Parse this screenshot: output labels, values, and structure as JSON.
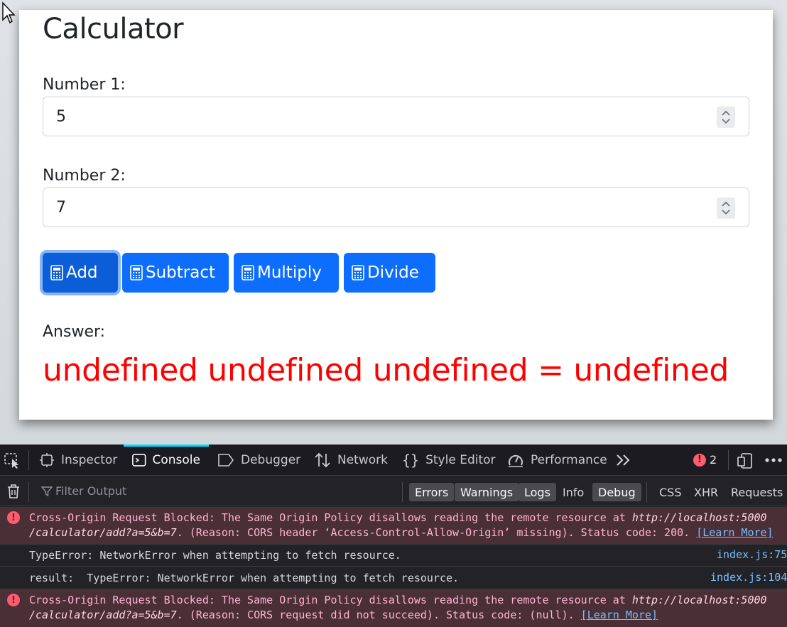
{
  "calculator": {
    "title": "Calculator",
    "number1_label": "Number 1:",
    "number1_value": "5",
    "number2_label": "Number 2:",
    "number2_value": "7",
    "buttons": {
      "add": "Add",
      "subtract": "Subtract",
      "multiply": "Multiply",
      "divide": "Divide"
    },
    "answer_label": "Answer:",
    "answer_value": "undefined undefined undefined = undefined",
    "accent_color": "#0d6efd",
    "answer_color": "#ff0000"
  },
  "devtools": {
    "tabs": {
      "inspector": "Inspector",
      "console": "Console",
      "debugger": "Debugger",
      "network": "Network",
      "style_editor": "Style Editor",
      "performance": "Performance"
    },
    "active_tab": "Console",
    "error_count": "2",
    "filter_placeholder": "Filter Output",
    "filters": {
      "errors": "Errors",
      "warnings": "Warnings",
      "logs": "Logs",
      "info": "Info",
      "debug": "Debug",
      "css": "CSS",
      "xhr": "XHR",
      "requests": "Requests"
    },
    "messages": [
      {
        "line1_pre": "Cross-Origin Request Blocked: The Same Origin Policy disallows reading the remote resource at ",
        "line1_url": "http://localhost:5000",
        "line2_url": "/calculator/add?a=5&b=7",
        "line2_post": ". (Reason: CORS header ‘Access-Control-Allow-Origin’ missing). Status code: 200. ",
        "link": "[Learn More]"
      },
      {
        "text": "TypeError: NetworkError when attempting to fetch resource.",
        "location": "index.js:75"
      },
      {
        "text": "result:  TypeError: NetworkError when attempting to fetch resource.",
        "location": "index.js:104"
      },
      {
        "line1_pre": "Cross-Origin Request Blocked: The Same Origin Policy disallows reading the remote resource at ",
        "line1_url": "http://localhost:5000",
        "line2_url": "/calculator/add?a=5&b=7",
        "line2_post": ". (Reason: CORS request did not succeed). Status code: (null). ",
        "link": "[Learn More]"
      }
    ]
  }
}
